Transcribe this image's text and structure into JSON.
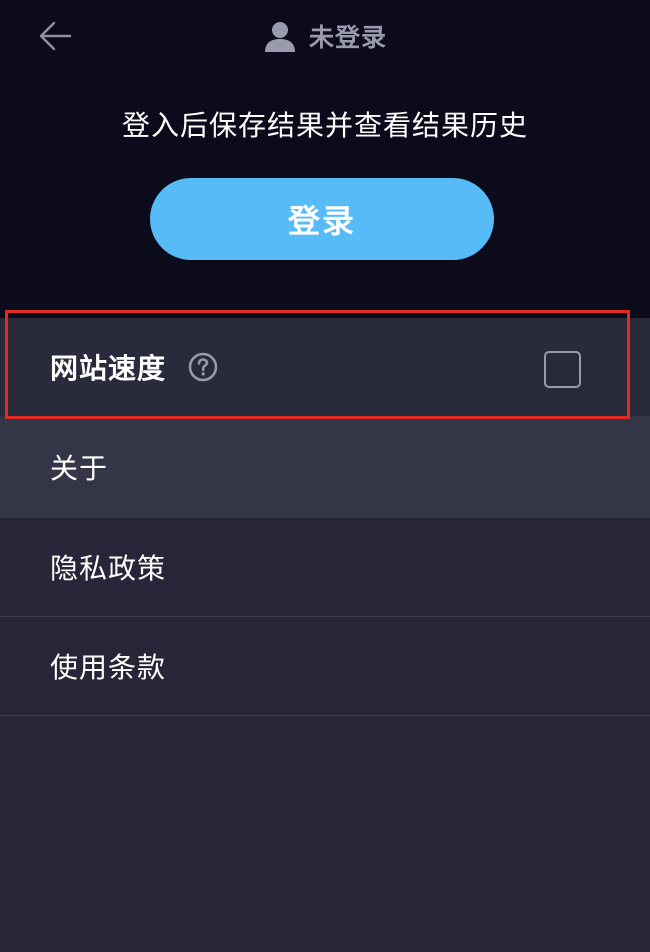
{
  "header": {
    "back_icon": "arrow-left-icon",
    "user_icon": "user-icon",
    "user_status": "未登录"
  },
  "login_section": {
    "prompt": "登入后保存结果并查看结果历史",
    "login_button_label": "登录"
  },
  "menu": {
    "items": [
      {
        "label": "网站速度",
        "has_help_icon": true,
        "has_checkbox": true,
        "checked": false
      },
      {
        "label": "关于"
      },
      {
        "label": "隐私政策"
      },
      {
        "label": "使用条款"
      }
    ]
  },
  "colors": {
    "top_background": "#0b0b1c",
    "body_background": "#262638",
    "accent_button": "#56bbf7",
    "highlight_border": "#e12b23",
    "muted_text": "#9a9aae"
  }
}
